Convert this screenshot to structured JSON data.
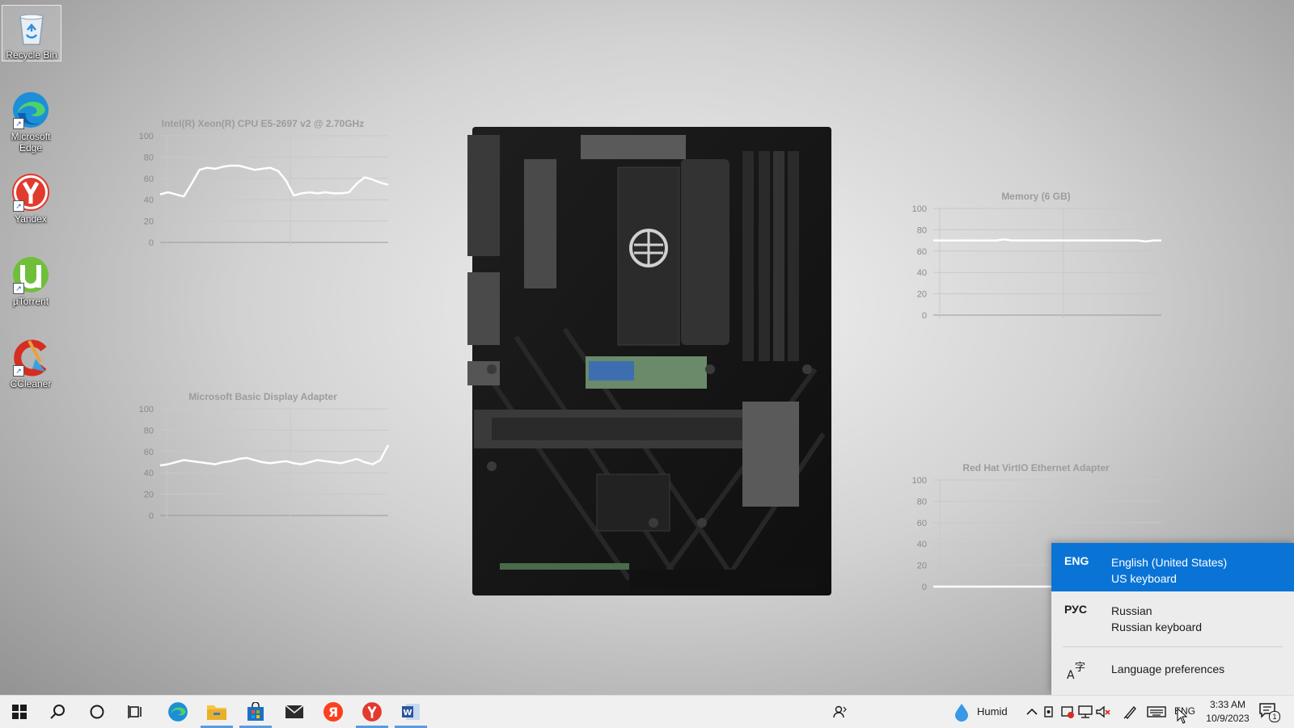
{
  "desktop_icons": [
    {
      "label": "Recycle Bin",
      "icon": "recycle-bin-icon"
    },
    {
      "label": "Microsoft Edge",
      "icon": "edge-icon"
    },
    {
      "label": "Yandex",
      "icon": "yandex-browser-icon"
    },
    {
      "label": "µTorrent",
      "icon": "utorrent-icon"
    },
    {
      "label": "CCleaner",
      "icon": "ccleaner-icon"
    }
  ],
  "widgets": {
    "cpu": {
      "title": "Intel(R) Xeon(R) CPU E5-2697 v2 @ 2.70GHz",
      "y_ticks": [
        "100",
        "80",
        "60",
        "40",
        "20",
        "0"
      ],
      "values": [
        45,
        47,
        45,
        43,
        55,
        68,
        70,
        69,
        71,
        72,
        72,
        70,
        68,
        69,
        70,
        67,
        58,
        44,
        46,
        47,
        46,
        47,
        46,
        46,
        47,
        55,
        61,
        59,
        56,
        54
      ]
    },
    "memory": {
      "title": "Memory (6 GB)",
      "y_ticks": [
        "100",
        "80",
        "60",
        "40",
        "20",
        "0"
      ],
      "values": [
        70,
        70,
        70,
        70,
        70,
        70,
        70,
        70,
        70,
        71,
        70,
        70,
        70,
        70,
        70,
        70,
        70,
        70,
        70,
        70,
        70,
        70,
        70,
        70,
        70,
        70,
        70,
        69,
        70,
        70
      ]
    },
    "gpu": {
      "title": "Microsoft Basic Display Adapter",
      "y_ticks": [
        "100",
        "80",
        "60",
        "40",
        "20",
        "0"
      ],
      "values": [
        47,
        48,
        50,
        52,
        51,
        50,
        49,
        48,
        50,
        51,
        53,
        54,
        52,
        50,
        49,
        50,
        51,
        49,
        48,
        50,
        52,
        51,
        50,
        49,
        51,
        53,
        50,
        48,
        52,
        66
      ]
    },
    "net": {
      "title": "Red Hat VirtIO Ethernet Adapter",
      "y_ticks": [
        "100",
        "80",
        "60",
        "40",
        "20",
        "0"
      ],
      "values": [
        0,
        0,
        0,
        0,
        0,
        0,
        0,
        0,
        0,
        0,
        0,
        0,
        0,
        0,
        0
      ]
    }
  },
  "language_flyout": {
    "items": [
      {
        "code": "ENG",
        "language": "English (United States)",
        "keyboard": "US keyboard",
        "active": true
      },
      {
        "code": "РУС",
        "language": "Russian",
        "keyboard": "Russian keyboard",
        "active": false
      }
    ],
    "preferences_label": "Language preferences"
  },
  "taskbar": {
    "pinned": [
      {
        "icon": "windows-start-icon",
        "running": false
      },
      {
        "icon": "search-icon",
        "running": false
      },
      {
        "icon": "cortana-icon",
        "running": false
      },
      {
        "icon": "task-view-icon",
        "running": false
      },
      {
        "icon": "edge-icon",
        "running": false
      },
      {
        "icon": "file-explorer-icon",
        "running": true
      },
      {
        "icon": "microsoft-store-icon",
        "running": true
      },
      {
        "icon": "mail-icon",
        "running": false
      },
      {
        "icon": "yandex-icon",
        "running": false
      },
      {
        "icon": "yandex-browser-icon",
        "running": true
      },
      {
        "icon": "word-icon",
        "running": true
      }
    ],
    "weather_label": "Humid",
    "language_indicator": "ENG",
    "clock_time": "3:33 AM",
    "clock_date": "10/9/2023",
    "notification_count": "1"
  },
  "colors": {
    "accent": "#0a74d6",
    "chart_line": "#ffffff",
    "chart_title": "#9c9c9c"
  }
}
